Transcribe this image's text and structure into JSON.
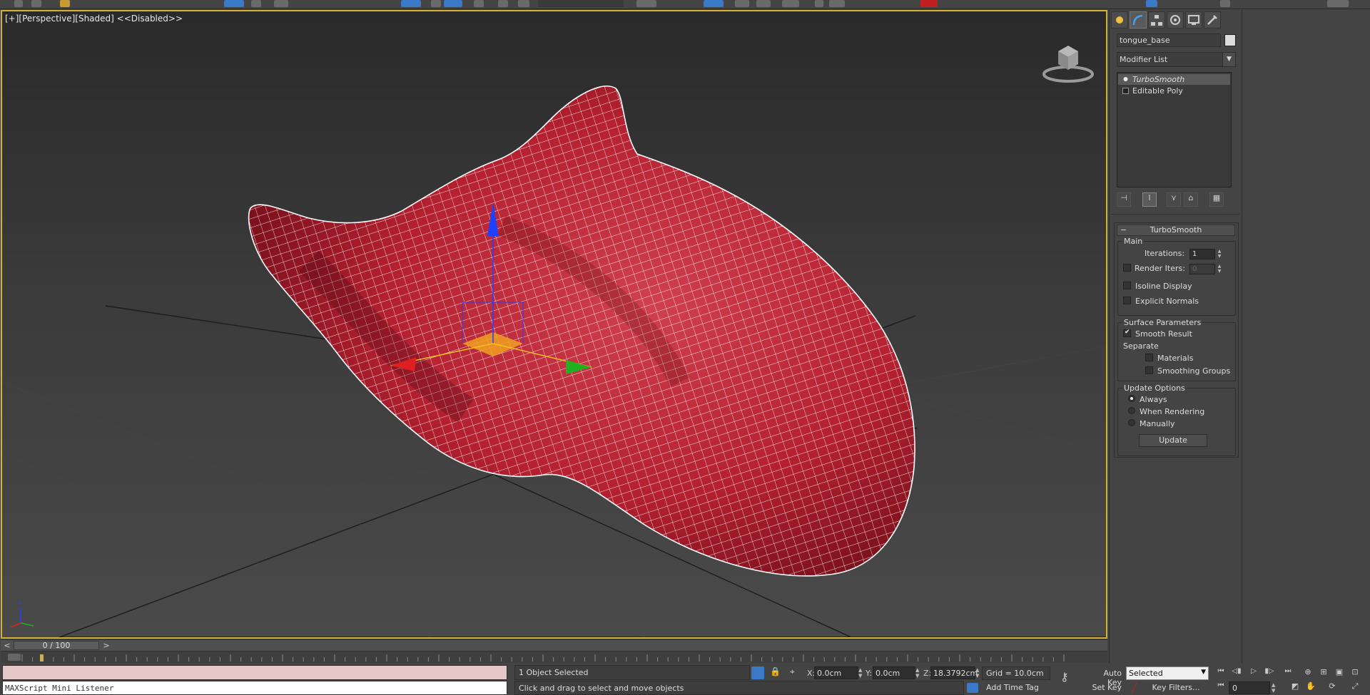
{
  "viewport": {
    "label": "[+][Perspective][Shaded] <<Disabled>>",
    "object_name": "tongue_base",
    "object_color": "#c8283a"
  },
  "timeline": {
    "prev": "<",
    "next": ">",
    "frame_label": "0 / 100",
    "current_frame_fraction": 0.0
  },
  "command_panel": {
    "tabs": [
      "create-icon",
      "modify-icon",
      "hierarchy-icon",
      "motion-icon",
      "display-icon",
      "utilities-icon"
    ],
    "active_tab": "modify-icon",
    "object_name": "tongue_base",
    "modifier_list": "Modifier List",
    "stack": [
      {
        "label": "TurboSmooth",
        "selected": true
      },
      {
        "label": "Editable Poly",
        "selected": false
      }
    ],
    "rollout": {
      "title": "TurboSmooth",
      "collapse": "−",
      "main": {
        "title": "Main",
        "iterations_label": "Iterations:",
        "iterations_value": "1",
        "render_iters_label": "Render Iters:",
        "render_iters_value": "0",
        "render_iters_checked": false,
        "isoline_label": "Isoline Display",
        "isoline_checked": false,
        "explicit_label": "Explicit Normals",
        "explicit_checked": false
      },
      "surface": {
        "title": "Surface Parameters",
        "smooth_result_label": "Smooth Result",
        "smooth_result_checked": true,
        "separate_label": "Separate",
        "materials_label": "Materials",
        "materials_checked": false,
        "smoothing_groups_label": "Smoothing Groups",
        "smoothing_groups_checked": false
      },
      "update": {
        "title": "Update Options",
        "always_label": "Always",
        "when_rendering_label": "When Rendering",
        "manually_label": "Manually",
        "selected": "Always",
        "update_button": "Update"
      }
    }
  },
  "status": {
    "maxscript": "MAXScript Mini Listener",
    "selection": "1 Object Selected",
    "prompt": "Click and drag to select and move objects",
    "x_label": "X:",
    "x_value": "0.0cm",
    "y_label": "Y:",
    "y_value": "0.0cm",
    "z_label": "Z:",
    "z_value": "18.3792cm",
    "grid": "Grid = 10.0cm",
    "add_time_tag": "Add Time Tag",
    "auto_key": "Auto Key",
    "set_key": "Set Key",
    "key_mode": "Selected",
    "key_filters": "Key Filters...",
    "current_frame": "0"
  },
  "colors": {
    "viewport_border": "#d6b030",
    "gizmo_x": "#e02020",
    "gizmo_y": "#20b020",
    "gizmo_z": "#2040ff",
    "plane_highlight": "#f0a020"
  }
}
